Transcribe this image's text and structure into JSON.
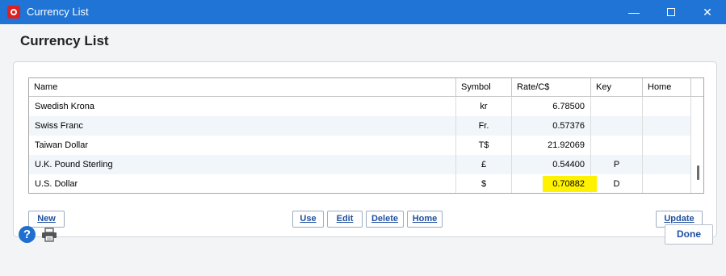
{
  "window": {
    "title": "Currency List",
    "minimize_glyph": "—",
    "close_glyph": "✕"
  },
  "page": {
    "title": "Currency List"
  },
  "table": {
    "columns": [
      "Name",
      "Symbol",
      "Rate/C$",
      "Key",
      "Home"
    ],
    "rows": [
      {
        "name": "Swedish Krona",
        "symbol": "kr",
        "rate": "6.78500",
        "key": "",
        "home": ""
      },
      {
        "name": "Swiss Franc",
        "symbol": "Fr.",
        "rate": "0.57376",
        "key": "",
        "home": ""
      },
      {
        "name": "Taiwan Dollar",
        "symbol": "T$",
        "rate": "21.92069",
        "key": "",
        "home": ""
      },
      {
        "name": "U.K. Pound Sterling",
        "symbol": "£",
        "rate": "0.54400",
        "key": "P",
        "home": ""
      },
      {
        "name": "U.S. Dollar",
        "symbol": "$",
        "rate": "0.70882",
        "key": "D",
        "home": ""
      }
    ],
    "highlight_color": "#fff200"
  },
  "buttons": {
    "new": "New",
    "use": "Use",
    "edit": "Edit",
    "delete": "Delete",
    "home": "Home",
    "update": "Update",
    "done": "Done"
  },
  "footer": {
    "help_glyph": "?"
  },
  "icons": [
    "app-logo-icon",
    "minimize-icon",
    "maximize-icon",
    "close-icon",
    "help-icon",
    "printer-icon"
  ],
  "colors": {
    "titlebar": "#1f74d6",
    "accent": "#2050a0"
  }
}
